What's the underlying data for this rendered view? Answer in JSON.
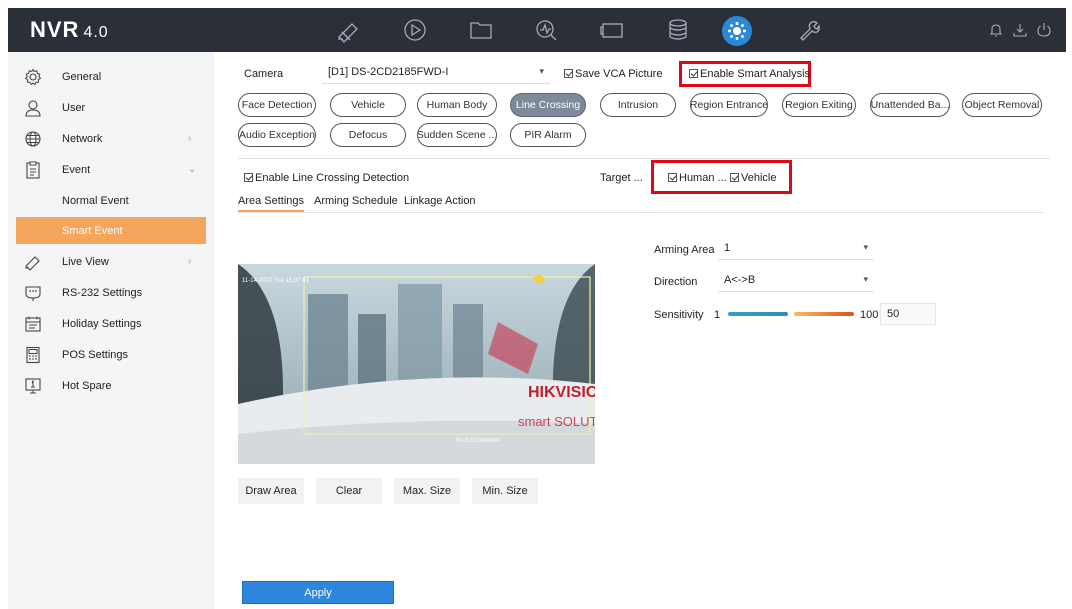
{
  "header": {
    "logo": "NVR",
    "version": "4.0",
    "nav_icons": [
      "live-view-icon",
      "playback-icon",
      "file-icon",
      "smart-analysis-icon",
      "vca-icon",
      "storage-icon",
      "configuration-icon",
      "maintenance-icon"
    ],
    "active_nav": "configuration-icon",
    "right_icons": [
      "alarm-bell-icon",
      "download-icon",
      "power-icon"
    ]
  },
  "sidebar": {
    "items": [
      {
        "label": "General",
        "icon": "gear-icon"
      },
      {
        "label": "User",
        "icon": "user-icon"
      },
      {
        "label": "Network",
        "icon": "globe-icon",
        "has_children": true
      },
      {
        "label": "Event",
        "icon": "clipboard-icon",
        "expanded": true
      },
      {
        "label": "Normal Event",
        "sub": true
      },
      {
        "label": "Smart Event",
        "sub": true,
        "selected": true
      },
      {
        "label": "Live View",
        "icon": "camera-icon",
        "has_children": true
      },
      {
        "label": "RS-232 Settings",
        "icon": "rs232-icon"
      },
      {
        "label": "Holiday Settings",
        "icon": "calendar-icon"
      },
      {
        "label": "POS Settings",
        "icon": "pos-icon"
      },
      {
        "label": "Hot Spare",
        "icon": "hot-spare-icon"
      }
    ]
  },
  "camera": {
    "label": "Camera",
    "value": "[D1] DS-2CD2185FWD-I",
    "save_vca": "Save VCA Picture",
    "enable_smart": "Enable Smart Analysis"
  },
  "event_types": [
    "Face Detection",
    "Vehicle",
    "Human Body",
    "Line Crossing",
    "Intrusion",
    "Region Entrance",
    "Region Exiting",
    "Unattended Ba...",
    "Object Removal",
    "Audio Exception",
    "Defocus",
    "Sudden Scene ...",
    "PIR Alarm"
  ],
  "active_event": "Line Crossing",
  "detection": {
    "enable_label": "Enable Line Crossing Detection",
    "target_label": "Target ...",
    "target_human": "Human ...",
    "target_vehicle": "Vehicle"
  },
  "tabs": [
    "Area Settings",
    "Arming Schedule",
    "Linkage Action"
  ],
  "active_tab": "Area Settings",
  "video": {
    "osd_time": "11-14-2017 Tue 15:07:41",
    "brand": "HIKVISION",
    "slogan": "smart SOLUTIO",
    "camera_osd": "DS-2CD2185FWD-I"
  },
  "buttons": {
    "draw_area": "Draw Area",
    "clear": "Clear",
    "max_size": "Max. Size",
    "min_size": "Min. Size",
    "apply": "Apply"
  },
  "settings": {
    "arming_area_label": "Arming Area",
    "arming_area_value": "1",
    "direction_label": "Direction",
    "direction_value": "A<->B",
    "sensitivity_label": "Sensitivity",
    "sensitivity_min": "1",
    "sensitivity_max": "100",
    "sensitivity_value": "50"
  },
  "colors": {
    "header_bg": "#2a2f38",
    "accent_orange": "#f5a55c",
    "apply_blue": "#2e86de",
    "highlight_red": "#e0061a"
  }
}
